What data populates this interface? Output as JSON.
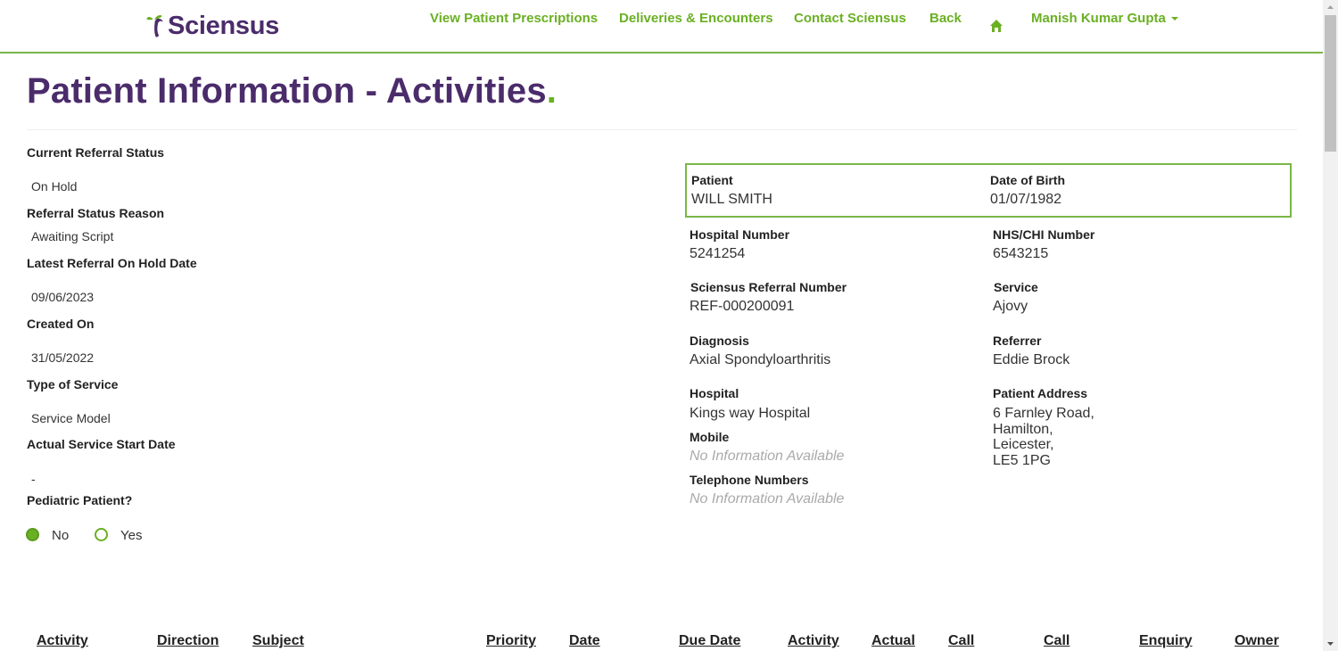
{
  "brand": {
    "name": "Sciensus"
  },
  "nav": {
    "prescriptions": "View Patient Prescriptions",
    "deliveries": "Deliveries & Encounters",
    "contact": "Contact Sciensus",
    "back": "Back",
    "home_icon": "home-icon",
    "user": "Manish Kumar Gupta"
  },
  "page": {
    "title": "Patient Information - Activities",
    "title_dot": "."
  },
  "referral": {
    "current_status_label": "Current Referral Status",
    "current_status": "On Hold",
    "status_reason_label": "Referral Status Reason",
    "status_reason": "Awaiting Script",
    "on_hold_date_label": "Latest Referral On Hold Date",
    "on_hold_date": "09/06/2023",
    "created_on_label": "Created On",
    "created_on": "31/05/2022",
    "type_of_service_label": "Type of Service",
    "type_of_service": "Service Model",
    "actual_start_label": "Actual Service Start Date",
    "actual_start": "-",
    "pediatric_label": "Pediatric Patient?",
    "pediatric_options": [
      "No",
      "Yes"
    ],
    "pediatric_selected": "No"
  },
  "patient": {
    "patient_label": "Patient",
    "patient_name": "WILL SMITH",
    "dob_label": "Date of Birth",
    "dob": "01/07/1982",
    "hospital_number_label": "Hospital Number",
    "hospital_number": "5241254",
    "nhs_label": "NHS/CHI Number",
    "nhs": "6543215",
    "referral_number_label": "Sciensus Referral Number",
    "referral_number": "REF-000200091",
    "service_label": "Service",
    "service": "Ajovy",
    "diagnosis_label": "Diagnosis",
    "diagnosis": "Axial Spondyloarthritis",
    "referrer_label": "Referrer",
    "referrer": "Eddie Brock",
    "hospital_label": "Hospital",
    "hospital": "Kings way Hospital",
    "address_label": "Patient Address",
    "address_lines": [
      "6 Farnley Road,",
      "Hamilton,",
      "Leicester,",
      "LE5 1PG"
    ],
    "mobile_label": "Mobile",
    "mobile": "No Information Available",
    "telephone_label": "Telephone Numbers",
    "telephone": "No Information Available"
  },
  "table": {
    "columns": [
      "Activity",
      "Direction",
      "Subject",
      "Priority",
      "Date",
      "Due Date",
      "Activity",
      "Actual",
      "Call",
      "Call",
      "Enquiry",
      "Owner"
    ]
  },
  "colors": {
    "brand_purple": "#4b2c6b",
    "accent_green": "#6ab023"
  }
}
